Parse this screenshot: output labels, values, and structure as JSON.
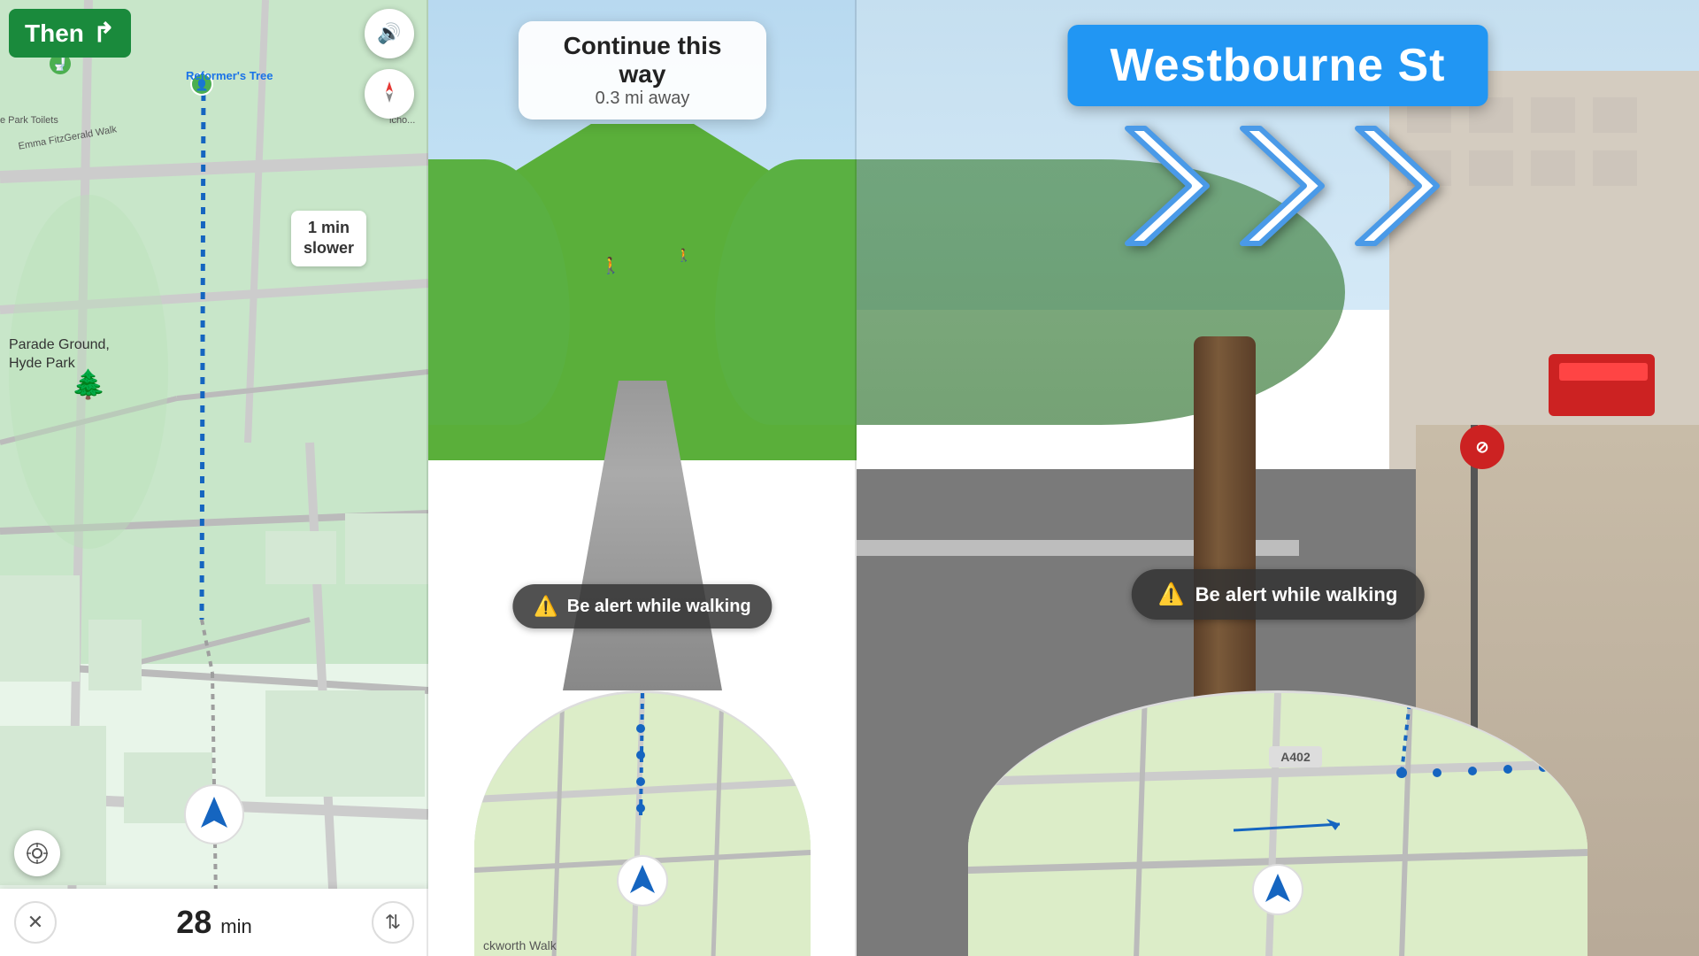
{
  "left": {
    "then_label": "Then",
    "then_arrow": "↱",
    "map_label": "Reformer's Tree",
    "slower_label": "1 min",
    "slower_sub": "slower",
    "time_value": "28",
    "time_unit": "min",
    "location_names": [
      "Emma FitzGerald Walk",
      "Parade Ground, Hyde Park",
      "e Park Toilets"
    ]
  },
  "middle": {
    "continue_main": "Continue this way",
    "continue_sub": "0.3 mi away",
    "alert_text": "Be alert while walking",
    "alert_icon": "⚠",
    "location_label": "ckworth Walk"
  },
  "right": {
    "street_sign": "Westbourne St",
    "alert_text": "Be alert while walking",
    "alert_icon": "⚠",
    "route_label": "A402"
  },
  "icons": {
    "sound": "🔊",
    "compass": "⬆",
    "close": "✕",
    "route_options": "⇅",
    "location_target": "⊙",
    "nav_arrow": "▲"
  }
}
